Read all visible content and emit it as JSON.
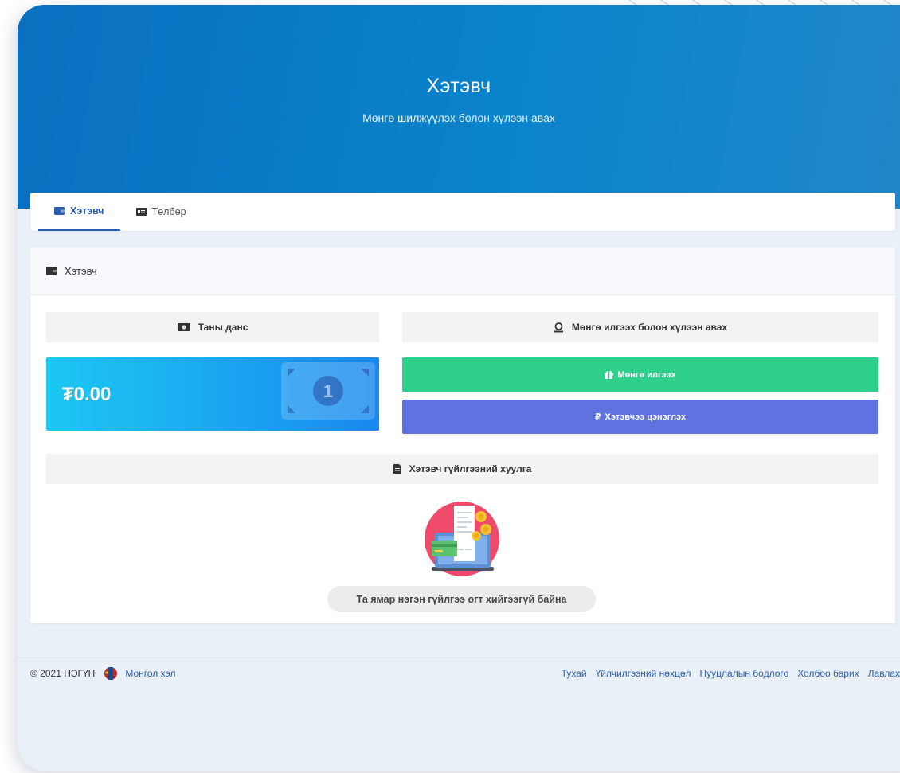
{
  "hero": {
    "title": "Хэтэвч",
    "subtitle": "Мөнгө шилжүүлэх болон хүлээн авах"
  },
  "tabs": [
    {
      "label": "Хэтэвч",
      "icon": "wallet-icon",
      "active": true
    },
    {
      "label": "Төлбөр",
      "icon": "payment-card-icon",
      "active": false
    }
  ],
  "panel": {
    "title": "Хэтэвч",
    "account_label": "Таны данс",
    "transfer_label": "Мөнгө илгээх болон хүлээн авах",
    "balance": "₮0.00",
    "send_button": "Мөнгө илгээх",
    "topup_button": "Хэтэвчээ цэнэглэх",
    "history_label": "Хэтэвч гүйлгээний хуулга",
    "empty_message": "Та ямар нэгэн гүйлгээ огт хийгээгүй байна"
  },
  "footer": {
    "copyright": "© 2021 НЭГҮН",
    "language": "Монгол хэл",
    "links": [
      "Тухай",
      "Үйлчилгээний нөхцөл",
      "Нууцлалын бодлого",
      "Холбоо барих",
      "Лавлах"
    ]
  },
  "colors": {
    "primary": "#2a5db0",
    "hero": "#0984cc",
    "send": "#2fcf8c",
    "topup": "#5f72e0",
    "balance_start": "#1cc8f2",
    "balance_end": "#1a88ef"
  }
}
